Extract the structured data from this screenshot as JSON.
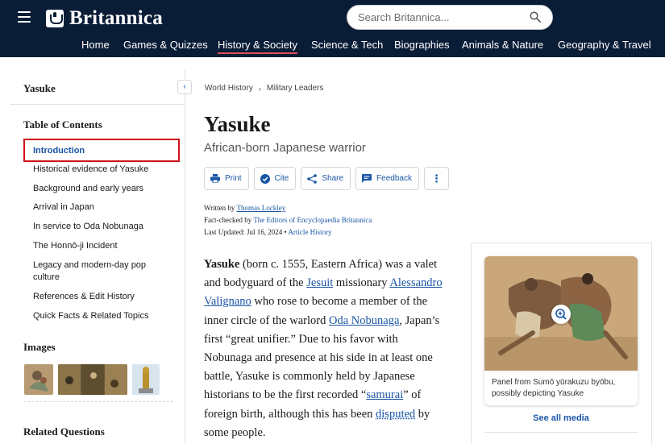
{
  "header": {
    "brand": "Britannica",
    "search_placeholder": "Search Britannica...",
    "nav": [
      "Home",
      "Games & Quizzes",
      "History & Society",
      "Science & Tech",
      "Biographies",
      "Animals & Nature",
      "Geography & Travel"
    ],
    "active_nav": "History & Society"
  },
  "sidebar": {
    "title": "Yasuke",
    "toc_title": "Table of Contents",
    "toc": [
      "Introduction",
      "Historical evidence of Yasuke",
      "Background and early years",
      "Arrival in Japan",
      "In service to Oda Nobunaga",
      "The Honnō-ji Incident",
      "Legacy and modern-day pop culture",
      "References & Edit History",
      "Quick Facts & Related Topics"
    ],
    "active_toc": "Introduction",
    "images_title": "Images",
    "related_title": "Related Questions"
  },
  "breadcrumb": [
    "World History",
    "Military Leaders"
  ],
  "article": {
    "title": "Yasuke",
    "subtitle": "African-born Japanese warrior",
    "actions": {
      "print": "Print",
      "cite": "Cite",
      "share": "Share",
      "feedback": "Feedback",
      "more": "⋮"
    },
    "meta": {
      "written_by_label": "Written by ",
      "author": "Thomas Lockley",
      "fact_checked_label": "Fact-checked by ",
      "fact_checker": "The Editors of Encyclopaedia Britannica",
      "updated_label": "Last Updated: Jul 16, 2024",
      "bullet": " • ",
      "history_link": "Article History"
    },
    "body": {
      "name": "Yasuke",
      "t1": " (born c. 1555, Eastern Africa) was a valet and bodyguard of the ",
      "l1": "Jesuit",
      "t2": " missionary ",
      "l2": "Alessandro Valignano",
      "t3": " who rose to become a member of the inner circle of the warlord ",
      "l3": "Oda Nobunaga",
      "t4": ", Japan’s first “great unifier.” Due to his favor with Nobunaga and presence at his side in at least one battle, Yasuke is commonly held by Japanese historians to be the first recorded “",
      "l4": "samurai",
      "t5": "” of foreign birth, although this has been ",
      "l5": "disputed",
      "t6": " by some people."
    }
  },
  "media": {
    "caption": "Panel from Sumō yūrakuzu byōbu, possibly depicting Yasuke",
    "see_all": "See all media"
  },
  "colors": {
    "header_bg": "#0a1d37",
    "link": "#1a56a6",
    "highlight": "#d0121b",
    "nav_underline": "#e0505a"
  }
}
